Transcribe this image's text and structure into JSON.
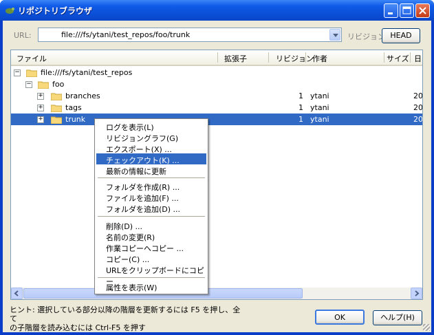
{
  "window": {
    "title": "リポジトリブラウザ"
  },
  "toolbar": {
    "url_label": "URL:",
    "url_value": "file:///fs/ytani/test_repos/foo/trunk",
    "revision_label": "リビジョン:",
    "head_button": "HEAD"
  },
  "columns": [
    "ファイル",
    "拡張子",
    "リビジョン",
    "作者",
    "サイズ",
    "日"
  ],
  "tree": [
    {
      "name": "file:///fs/ytani/test_repos",
      "revision": "",
      "author": "",
      "date": ""
    },
    {
      "name": "foo",
      "revision": "",
      "author": "",
      "date": ""
    },
    {
      "name": "branches",
      "revision": "1",
      "author": "ytani",
      "date": "20"
    },
    {
      "name": "tags",
      "revision": "1",
      "author": "ytani",
      "date": "20"
    },
    {
      "name": "trunk",
      "revision": "1",
      "author": "ytani",
      "date": "20"
    }
  ],
  "context_menu": {
    "items": [
      "ログを表示(L)",
      "リビジョングラフ(G)",
      "エクスポート(X) ...",
      "チェックアウト(K) ...",
      "最新の情報に更新",
      "フォルダを作成(R) ...",
      "ファイルを追加(F) ...",
      "フォルダを追加(D) ...",
      "削除(D) ...",
      "名前の変更(R)",
      "作業コピーへコピー ...",
      "コピー(C) ...",
      "URLをクリップボードにコピー",
      "属性を表示(W)"
    ],
    "highlighted_index": 3
  },
  "footer": {
    "hint_line1": "ヒント: 選択している部分以降の階層を更新するには F5 を押し、全て",
    "hint_line2": "の子階層を読み込むには Ctrl-F5 を押す",
    "ok_button": "OK",
    "help_button": "ヘルプ(H)"
  },
  "colors": {
    "selection": "#316ac5",
    "titlebar": "#0a4fd6",
    "folder": "#f7d87a"
  }
}
